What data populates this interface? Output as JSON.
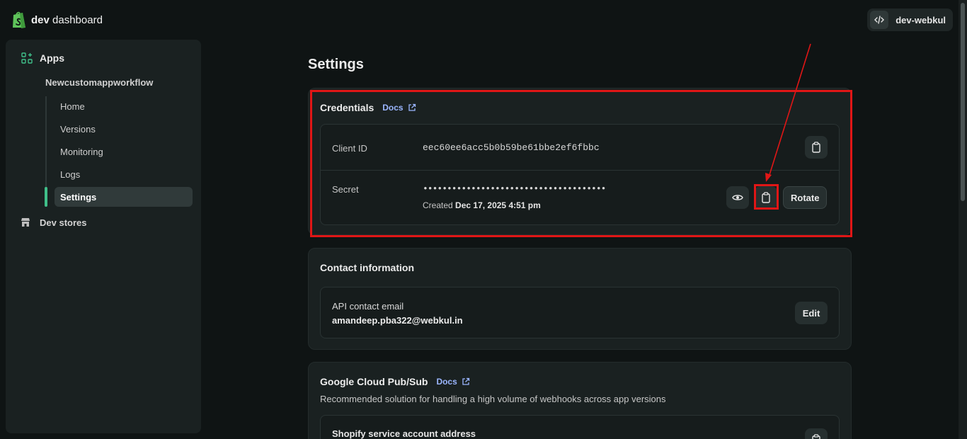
{
  "brand": {
    "bold": "dev",
    "rest": " dashboard"
  },
  "org": {
    "name": "dev-webkul"
  },
  "sidebar": {
    "apps_label": "Apps",
    "app_name": "Newcustomappworkflow",
    "items": [
      {
        "label": "Home"
      },
      {
        "label": "Versions"
      },
      {
        "label": "Monitoring"
      },
      {
        "label": "Logs"
      },
      {
        "label": "Settings",
        "active": true
      }
    ],
    "dev_stores_label": "Dev stores"
  },
  "page": {
    "title": "Settings"
  },
  "credentials": {
    "title": "Credentials",
    "docs_label": "Docs",
    "client_id_label": "Client ID",
    "client_id_value": "eec60ee6acc5b0b59be61bbe2ef6fbbc",
    "secret_label": "Secret",
    "secret_value": "••••••••••••••••••••••••••••••••••••••",
    "created_prefix": "Created",
    "created_date": "Dec 17, 2025 4:51 pm",
    "rotate_label": "Rotate"
  },
  "contact": {
    "title": "Contact information",
    "email_label": "API contact email",
    "email_value": "amandeep.pba322@webkul.in",
    "edit_label": "Edit"
  },
  "pubsub": {
    "title": "Google Cloud Pub/Sub",
    "docs_label": "Docs",
    "description": "Recommended solution for handling a high volume of webhooks across app versions",
    "service_account_label": "Shopify service account address"
  },
  "colors": {
    "background": "#0f1414",
    "panel": "#1a2121",
    "accent_green": "#3fbf89",
    "link": "#9bb6ff",
    "annotation_red": "#e01616"
  }
}
